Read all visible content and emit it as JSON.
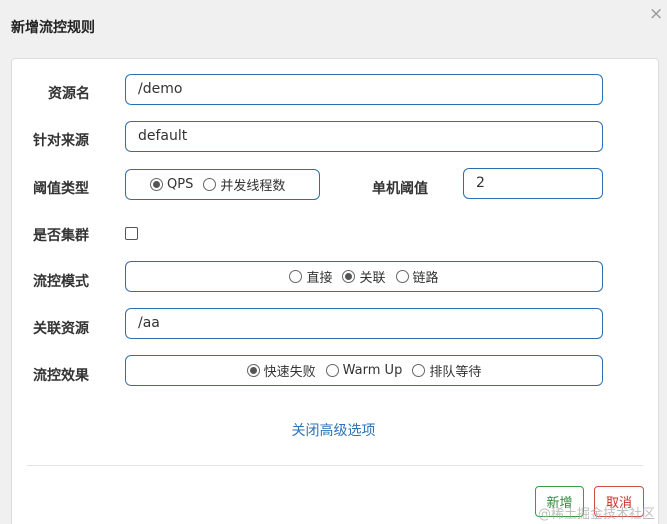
{
  "dialog": {
    "title": "新增流控规则",
    "close_glyph": "×"
  },
  "form": {
    "resource_name": {
      "label": "资源名",
      "value": "/demo"
    },
    "limit_app": {
      "label": "针对来源",
      "value": "default"
    },
    "threshold_type": {
      "label": "阈值类型",
      "options": [
        "QPS",
        "并发线程数"
      ],
      "selected": "QPS"
    },
    "single_threshold": {
      "label": "单机阈值",
      "value": "2"
    },
    "cluster": {
      "label": "是否集群",
      "checked": false
    },
    "strategy": {
      "label": "流控模式",
      "options": [
        "直接",
        "关联",
        "链路"
      ],
      "selected": "关联"
    },
    "ref_resource": {
      "label": "关联资源",
      "value": "/aa"
    },
    "control_behavior": {
      "label": "流控效果",
      "options": [
        "快速失败",
        "Warm Up",
        "排队等待"
      ],
      "selected": "快速失败"
    }
  },
  "advanced_link": "关闭高级选项",
  "buttons": {
    "add": "新增",
    "cancel": "取消"
  },
  "watermark": "@稀土掘金技术社区",
  "colors": {
    "input_border": "#2c6fb0",
    "link": "#2c72b8",
    "add_button": "#2e8b3a",
    "cancel_button": "#c9302c"
  }
}
